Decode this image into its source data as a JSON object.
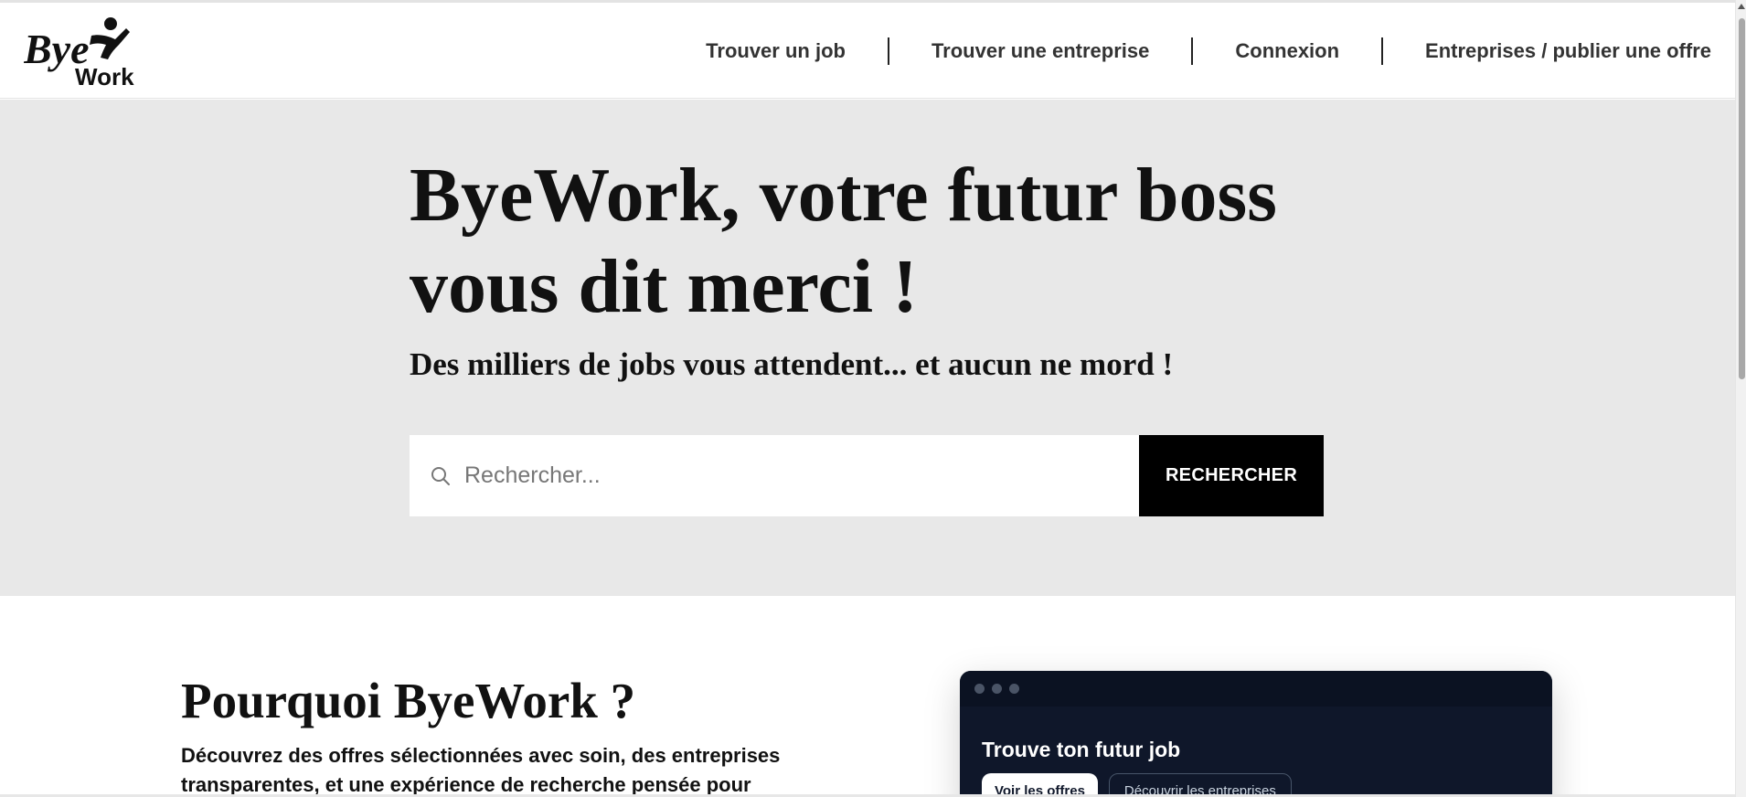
{
  "header": {
    "logo_alt": "ByeWork",
    "nav": [
      "Trouver un job",
      "Trouver une entreprise",
      "Connexion",
      "Entreprises / publier une offre"
    ],
    "logo_word_bye": "Bye",
    "logo_word_work": "Work"
  },
  "hero": {
    "title_line1": "ByeWork, votre futur boss",
    "title_line2": "vous dit merci !",
    "subtitle": "Des milliers de jobs vous attendent... et aucun ne mord !",
    "search_placeholder": "Rechercher...",
    "search_button": "RECHERCHER"
  },
  "why": {
    "title": "Pourquoi ByeWork ?",
    "text": "Découvrez des offres sélectionnées avec soin, des entreprises transparentes, et une expérience de recherche pensée pour"
  },
  "card": {
    "title": "Trouve ton futur job",
    "primary_button": "Voir les offres",
    "secondary_button": "Découvrir les entreprises"
  },
  "icons": {
    "search": "search-icon",
    "logo": "byework-logo-icon"
  },
  "colors": {
    "hero_bg": "#e8e8e8",
    "button_bg": "#000000",
    "card_bg": "#0f172a"
  }
}
